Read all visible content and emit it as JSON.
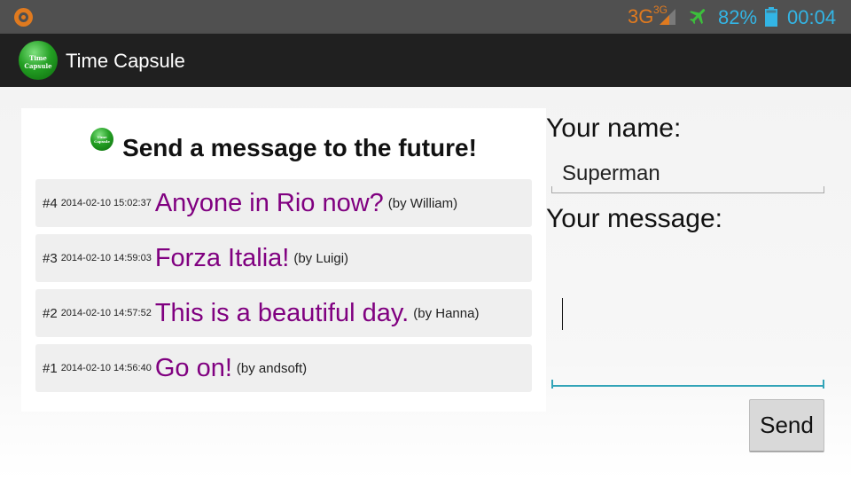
{
  "status_bar": {
    "network": "3G",
    "network_small": "3G",
    "battery": "82%",
    "time": "00:04",
    "colors": {
      "network": "#e07a1f",
      "system": "#33b5e5",
      "airplane": "#3cbf3c"
    }
  },
  "action_bar": {
    "logo_text": "Time Capsule",
    "title": "Time Capsule"
  },
  "panel": {
    "heading": "Send a message to the future!",
    "icon_text": "Time Capsule"
  },
  "messages": [
    {
      "num": "#4",
      "time": "2014-02-10 15:02:37",
      "text": "Anyone in Rio now?",
      "author": "(by William)"
    },
    {
      "num": "#3",
      "time": "2014-02-10 14:59:03",
      "text": "Forza Italia!",
      "author": "(by Luigi)"
    },
    {
      "num": "#2",
      "time": "2014-02-10 14:57:52",
      "text": "This is a beautiful day.",
      "author": "(by Hanna)"
    },
    {
      "num": "#1",
      "time": "2014-02-10 14:56:40",
      "text": "Go on!",
      "author": "(by andsoft)"
    }
  ],
  "form": {
    "name_label": "Your name:",
    "name_value": "Superman",
    "message_label": "Your message:",
    "message_value": "",
    "send_label": "Send"
  },
  "colors": {
    "message_text": "#800080",
    "accent": "#33a4b8"
  }
}
